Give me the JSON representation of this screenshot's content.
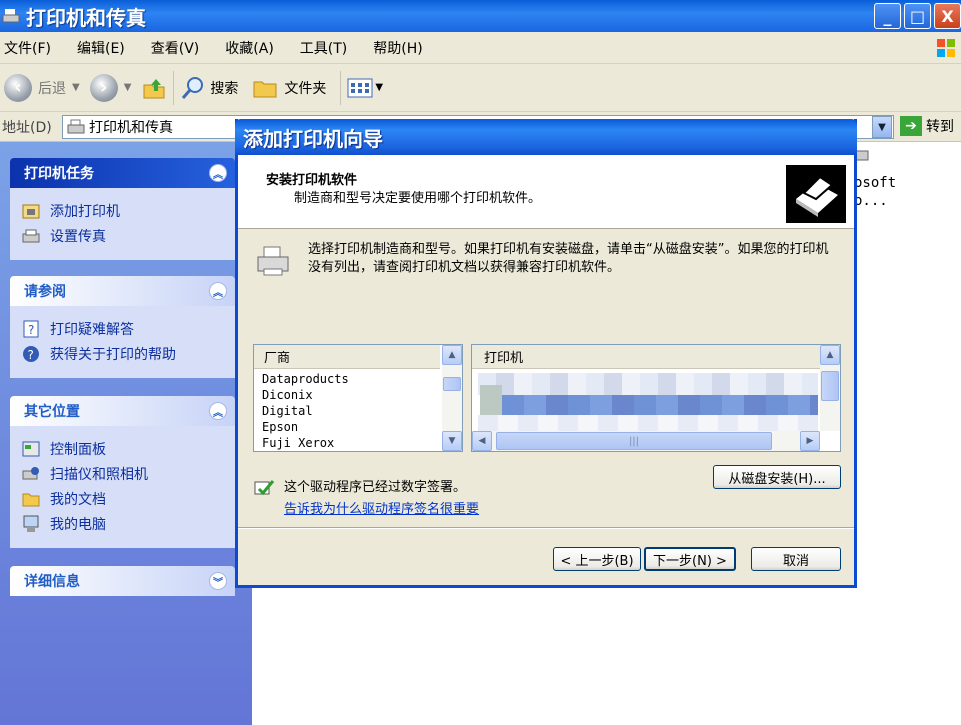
{
  "window": {
    "title": "打印机和传真",
    "buttons": [
      "_",
      "□",
      "X"
    ]
  },
  "menubar": [
    "文件(F)",
    "编辑(E)",
    "查看(V)",
    "收藏(A)",
    "工具(T)",
    "帮助(H)"
  ],
  "toolbar": {
    "back": "后退",
    "search": "搜索",
    "folders": "文件夹"
  },
  "address": {
    "label": "地址(D)",
    "value": "打印机和传真",
    "go": "转到"
  },
  "leftpane": {
    "printer_tasks": {
      "title": "打印机任务",
      "items": [
        "添加打印机",
        "设置传真"
      ]
    },
    "see_also": {
      "title": "请参阅",
      "items": [
        "打印疑难解答",
        "获得关于打印的帮助"
      ]
    },
    "other_places": {
      "title": "其它位置",
      "items": [
        "控制面板",
        "扫描仪和照相机",
        "我的文档",
        "我的电脑"
      ]
    },
    "details": {
      "title": "详细信息"
    }
  },
  "right_item": {
    "line1": "osoft",
    "line2": "o..."
  },
  "wizard": {
    "title": "添加打印机向导",
    "header_title": "安装打印机软件",
    "header_subtitle": "制造商和型号决定要使用哪个打印机软件。",
    "description": "选择打印机制造商和型号。如果打印机有安装磁盘，请单击“从磁盘安装”。如果您的打印机没有列出，请查阅打印机文档以获得兼容打印机软件。",
    "manufacturer_header": "厂商",
    "manufacturers": [
      "Dataproducts",
      "Diconix",
      "Digital",
      "Epson",
      "Fuji Xerox"
    ],
    "printer_header": "打印机",
    "signed_text": "这个驱动程序已经过数字签署。",
    "signed_link": "告诉我为什么驱动程序签名很重要",
    "have_disk": "从磁盘安装(H)...",
    "back": "< 上一步(B)",
    "next": "下一步(N) >",
    "cancel": "取消"
  }
}
